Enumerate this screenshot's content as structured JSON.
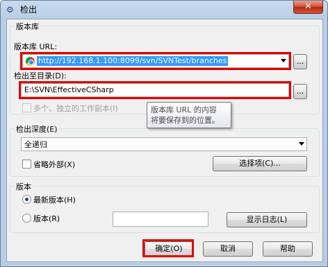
{
  "window": {
    "title": "检出",
    "title_icon": "svn-checkout-icon",
    "close_glyph": "✕"
  },
  "repository": {
    "group_label": "版本库",
    "url_label": "版本库 URL:",
    "url_value": "http://192.168.1.100:8099/svn/SVNTest/branches",
    "browse_label": "..."
  },
  "checkout_dir": {
    "label": "检出至目录(D):",
    "value": "E:\\SVN\\EffectiveCSharp",
    "browse_label": "..."
  },
  "multiple_working_copies": {
    "label": "多个、独立的工作副本(I)"
  },
  "tooltip": {
    "line1": "版本库 URL 的内容",
    "line2": "将要保存到的位置。"
  },
  "depth": {
    "group_label": "检出深度(E)",
    "selected": "全递归",
    "omit_externals_label": "省略外部(X)",
    "options_button": "选择项(C)..."
  },
  "revision": {
    "group_label": "版本",
    "head_label": "最新版本(H)",
    "revision_label": "版本(R)",
    "revision_value": "",
    "show_log_button": "显示日志(L)"
  },
  "footer": {
    "ok_button": "确定(O)",
    "cancel_button": "取消",
    "help_button": "帮助"
  }
}
